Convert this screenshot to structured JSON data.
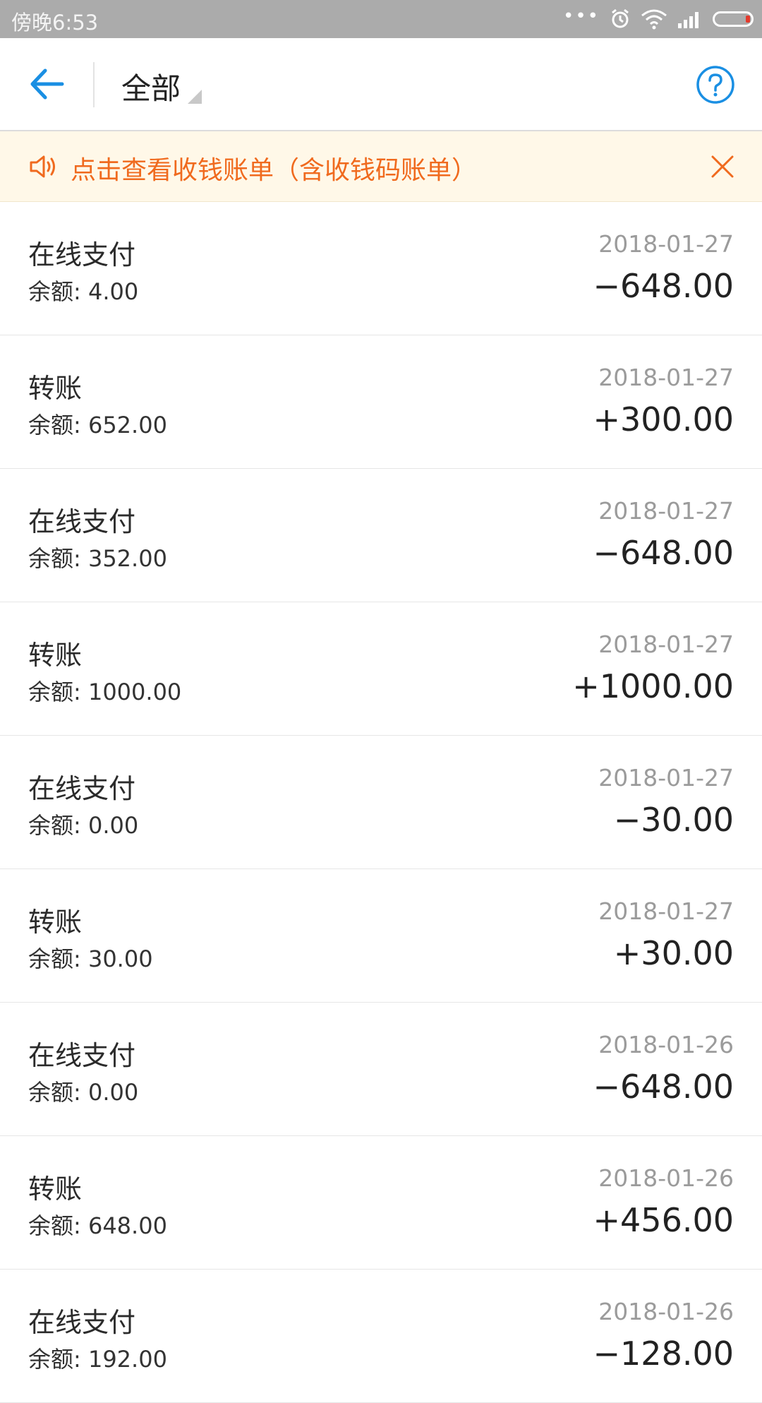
{
  "status_bar": {
    "time": "傍晚6:53",
    "icons": [
      "more-dots-icon",
      "alarm-icon",
      "wifi-icon",
      "signal-icon",
      "battery-icon"
    ]
  },
  "nav": {
    "filter_label": "全部",
    "back_icon": "arrow-left-icon",
    "help_icon": "help-circle-icon",
    "accent_color": "#1a8fe3"
  },
  "notice": {
    "text": "点击查看收钱账单（含收钱码账单）",
    "color": "#f06a1e",
    "background": "#fff8e8"
  },
  "transactions": [
    {
      "title": "在线支付",
      "balance": "余额: 4.00",
      "date": "2018-01-27",
      "amount": "−648.00"
    },
    {
      "title": "转账",
      "balance": "余额: 652.00",
      "date": "2018-01-27",
      "amount": "+300.00"
    },
    {
      "title": "在线支付",
      "balance": "余额: 352.00",
      "date": "2018-01-27",
      "amount": "−648.00"
    },
    {
      "title": "转账",
      "balance": "余额: 1000.00",
      "date": "2018-01-27",
      "amount": "+1000.00"
    },
    {
      "title": "在线支付",
      "balance": "余额: 0.00",
      "date": "2018-01-27",
      "amount": "−30.00"
    },
    {
      "title": "转账",
      "balance": "余额: 30.00",
      "date": "2018-01-27",
      "amount": "+30.00"
    },
    {
      "title": "在线支付",
      "balance": "余额: 0.00",
      "date": "2018-01-26",
      "amount": "−648.00"
    },
    {
      "title": "转账",
      "balance": "余额: 648.00",
      "date": "2018-01-26",
      "amount": "+456.00"
    },
    {
      "title": "在线支付",
      "balance": "余额: 192.00",
      "date": "2018-01-26",
      "amount": "−128.00"
    }
  ]
}
